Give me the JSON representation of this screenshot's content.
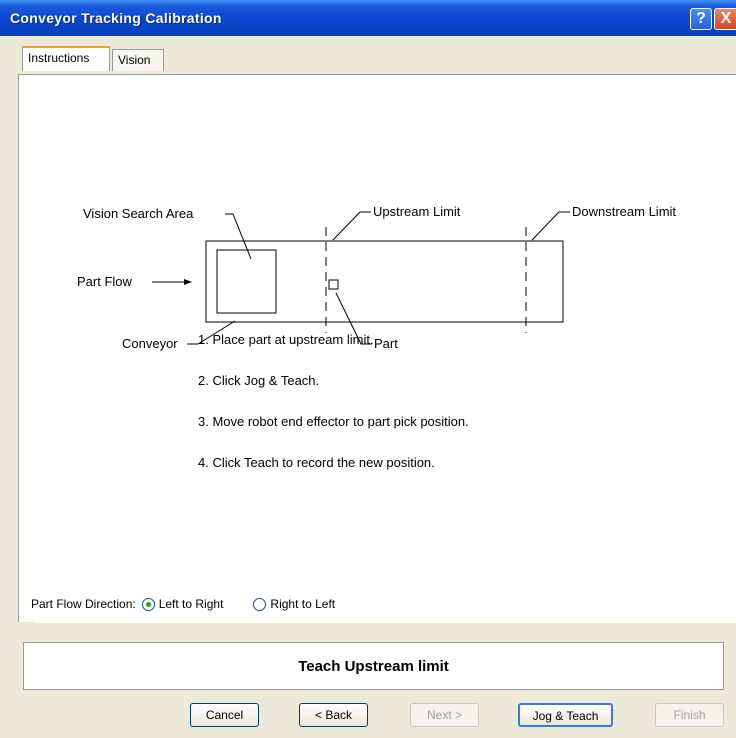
{
  "window": {
    "title": "Conveyor Tracking Calibration",
    "help": "?",
    "close": "X"
  },
  "tabs": [
    {
      "label": "Instructions",
      "active": true
    },
    {
      "label": "Vision",
      "active": false
    }
  ],
  "diagram": {
    "vision_search_area": "Vision Search Area",
    "upstream_limit": "Upstream Limit",
    "downstream_limit": "Downstream Limit",
    "part_flow": "Part Flow",
    "conveyor": "Conveyor",
    "part": "Part"
  },
  "steps": [
    "1. Place part at upstream limit.",
    "2. Click Jog & Teach.",
    "3. Move robot end effector to part pick position.",
    "4. Click Teach to record the new position."
  ],
  "flow_direction": {
    "label": "Part Flow Direction:",
    "options": [
      {
        "label": "Left to Right",
        "selected": true
      },
      {
        "label": "Right to Left",
        "selected": false
      }
    ]
  },
  "status": "Teach Upstream limit",
  "buttons": {
    "cancel": "Cancel",
    "back": "< Back",
    "next": "Next >",
    "jog_teach": "Jog & Teach",
    "finish": "Finish"
  }
}
